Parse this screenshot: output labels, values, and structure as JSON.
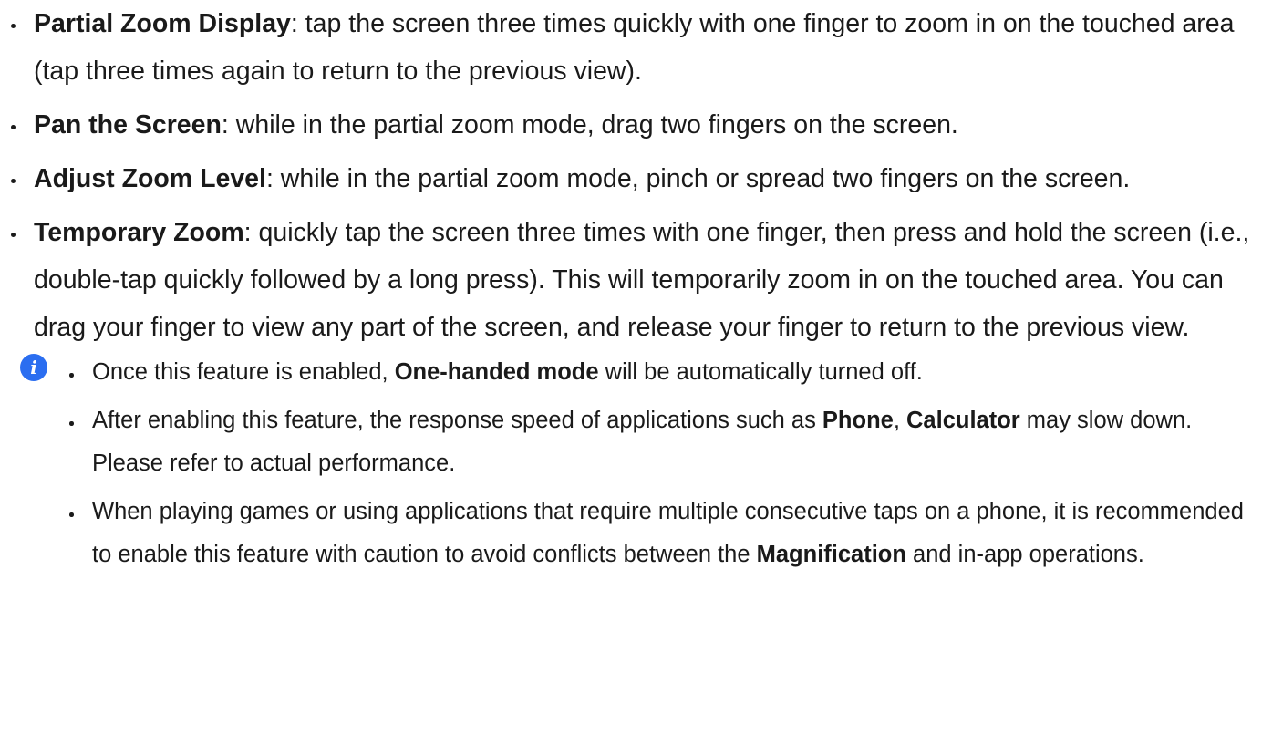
{
  "bullets": [
    {
      "title": "Partial Zoom Display",
      "text": ": tap the screen three times quickly with one finger to zoom in on the touched area (tap three times again to return to the previous view)."
    },
    {
      "title": "Pan the Screen",
      "text": ": while in the partial zoom mode, drag two fingers on the screen."
    },
    {
      "title": "Adjust Zoom Level",
      "text": ": while in the partial zoom mode, pinch or spread two fingers on the screen."
    },
    {
      "title": "Temporary Zoom",
      "text": ": quickly tap the screen three times with one finger, then press and hold the screen (i.e., double-tap quickly followed by a long press). This will temporarily zoom in on the touched area. You can drag your finger to view any part of the screen, and release your finger to return to the previous view."
    }
  ],
  "note": {
    "icon": "info-icon",
    "icon_glyph": "i",
    "items": [
      {
        "pre": "Once this feature is enabled, ",
        "bold1": "One-handed mode",
        "post": " will be automatically turned off."
      },
      {
        "pre": "After enabling this feature, the response speed of applications such as ",
        "bold1": "Phone",
        "mid": ", ",
        "bold2": "Calculator",
        "post": " may slow down. Please refer to actual performance."
      },
      {
        "pre": "When playing games or using applications that require multiple consecutive taps on a phone, it is recommended to enable this feature with caution to avoid conflicts between the ",
        "bold1": "Magnification",
        "post": " and in-app operations."
      }
    ]
  }
}
